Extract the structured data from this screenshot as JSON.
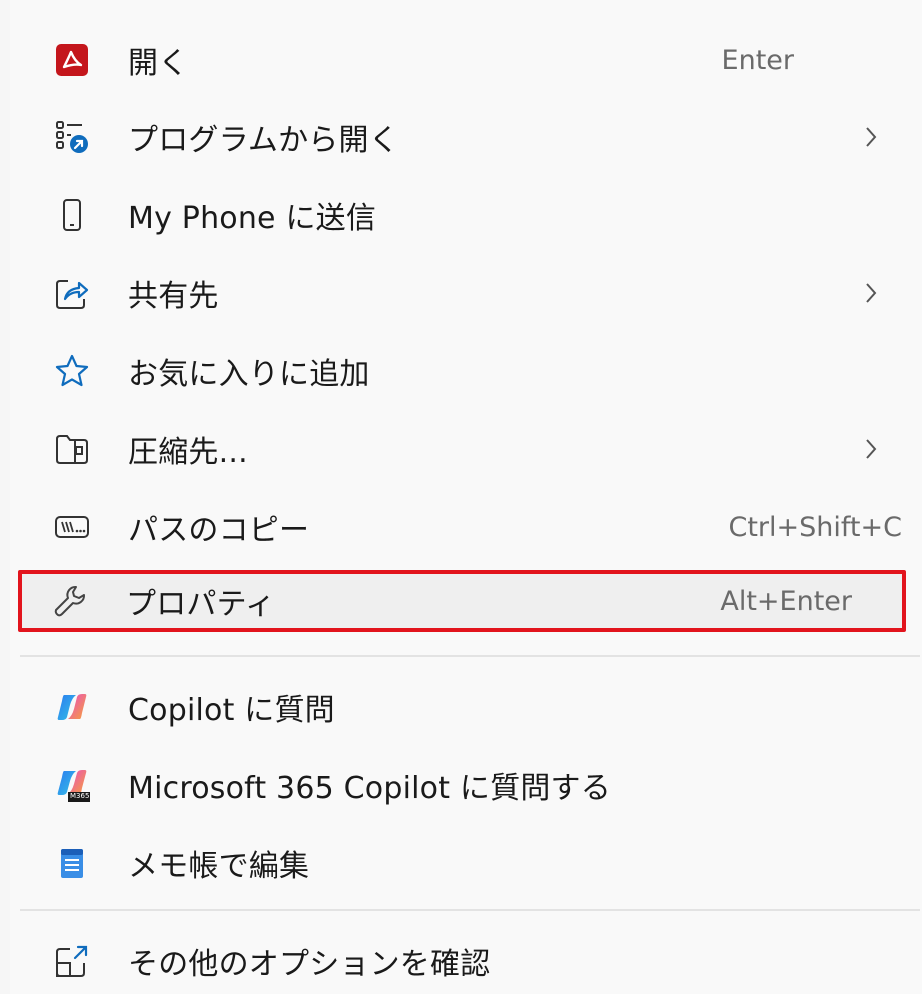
{
  "menu": {
    "items": [
      {
        "label": "開く",
        "shortcut": "Enter",
        "icon": "pdf-icon",
        "submenu": false
      },
      {
        "label": "プログラムから開く",
        "shortcut": "",
        "icon": "open-with-icon",
        "submenu": true
      },
      {
        "label": "My Phone に送信",
        "shortcut": "",
        "icon": "phone-icon",
        "submenu": false
      },
      {
        "label": "共有先",
        "shortcut": "",
        "icon": "share-icon",
        "submenu": true
      },
      {
        "label": "お気に入りに追加",
        "shortcut": "",
        "icon": "star-icon",
        "submenu": false
      },
      {
        "label": "圧縮先...",
        "shortcut": "",
        "icon": "zip-folder-icon",
        "submenu": true
      },
      {
        "label": "パスのコピー",
        "shortcut": "Ctrl+Shift+C",
        "icon": "copy-path-icon",
        "submenu": false
      },
      {
        "label": "プロパティ",
        "shortcut": "Alt+Enter",
        "icon": "wrench-icon",
        "submenu": false,
        "highlighted": true
      },
      {
        "label": "Copilot に質問",
        "shortcut": "",
        "icon": "copilot-icon",
        "submenu": false
      },
      {
        "label": "Microsoft 365 Copilot に質問する",
        "shortcut": "",
        "icon": "m365-copilot-icon",
        "submenu": false
      },
      {
        "label": "メモ帳で編集",
        "shortcut": "",
        "icon": "notepad-icon",
        "submenu": false
      },
      {
        "label": "その他のオプションを確認",
        "shortcut": "",
        "icon": "more-options-icon",
        "submenu": false
      }
    ],
    "m365_badge": "M365"
  },
  "colors": {
    "highlight_border": "#e2141d",
    "accent_blue": "#0f6cbd",
    "pdf_red": "#c4161c"
  }
}
